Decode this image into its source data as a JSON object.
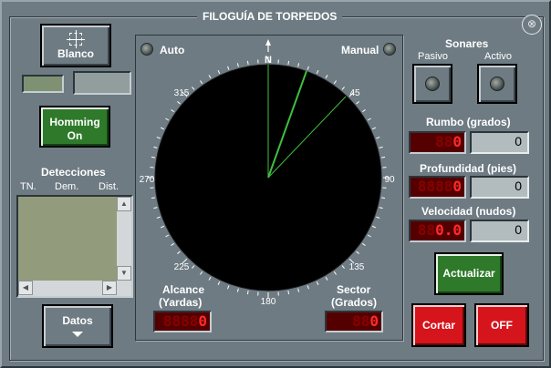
{
  "title": "FILOGUÍA DE TORPEDOS",
  "close_icon": "close-circle-x",
  "blanco_button": "Blanco",
  "homing_button": {
    "line1": "Homming",
    "line2": "On"
  },
  "detections": {
    "label": "Detecciones",
    "columns": [
      "TN.",
      "Dem.",
      "Dist."
    ]
  },
  "datos_button": "Datos",
  "radar": {
    "auto_label": "Auto",
    "manual_label": "Manual",
    "north_label": "N",
    "bearing_labels": [
      "45",
      "90",
      "135",
      "180",
      "225",
      "270",
      "315"
    ]
  },
  "alcance": {
    "label_line1": "Alcance",
    "label_line2": "(Yardas)",
    "digits_dim": "8888",
    "digits_lit": "0"
  },
  "sector": {
    "label_line1": "Sector",
    "label_line2": "(Grados)",
    "digits_dim": "88",
    "digits_lit": "0"
  },
  "sonares": {
    "label": "Sonares",
    "pasivo": "Pasivo",
    "activo": "Activo"
  },
  "rumbo": {
    "label": "Rumbo (grados)",
    "digits_dim": "88",
    "digits_lit": "0",
    "value": "0"
  },
  "profundidad": {
    "label": "Profundidad (pies)",
    "digits_dim": "8888",
    "digits_lit": "0",
    "value": "0"
  },
  "velocidad": {
    "label": "Velocidad (nudos)",
    "digits_dim": "88",
    "digits_lit": "0.0",
    "value": "0"
  },
  "actualizar_button": "Actualizar",
  "cortar_button": "Cortar",
  "off_button": "OFF",
  "colors": {
    "panel": "#6e7b83",
    "radar": "#000000",
    "sweep": "#3fbf3f",
    "led_red": "#ff2a2a",
    "button_green": "#2e7a2a",
    "button_red": "#d6141c"
  }
}
